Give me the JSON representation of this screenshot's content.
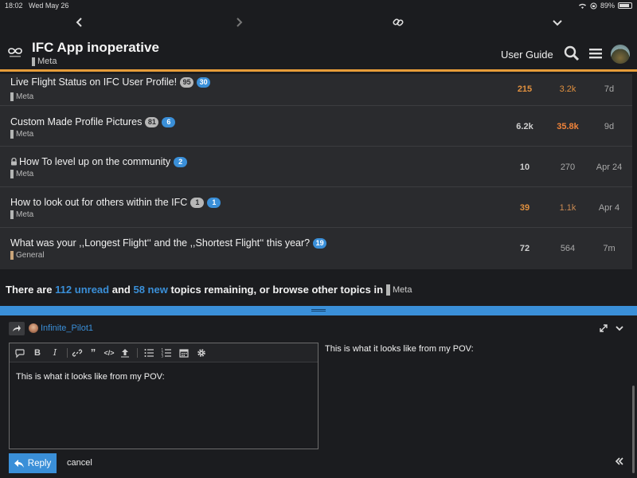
{
  "status": {
    "time": "18:02",
    "date": "Wed May 26",
    "battery": "89%",
    "battery_level": 0.89
  },
  "header": {
    "title": "IFC App inoperative",
    "category": "Meta",
    "category_color": "#b3b5b4",
    "user_guide": "User Guide"
  },
  "topics": [
    {
      "title": "Live Flight Status on IFC User Profile!",
      "badges": [
        "95",
        "30"
      ],
      "category": "Meta",
      "category_color": "#b3b5b4",
      "replies": "215",
      "views": "3.2k",
      "activity": "7d",
      "replies_color": "#e0903f",
      "views_color": "#e0903f",
      "locked": false
    },
    {
      "title": "Custom Made Profile Pictures",
      "badges": [
        "81",
        "6"
      ],
      "category": "Meta",
      "category_color": "#b3b5b4",
      "replies": "6.2k",
      "views": "35.8k",
      "activity": "9d",
      "replies_color": "#d0d0d0",
      "views_color": "#f0833a",
      "locked": false
    },
    {
      "title": "How To level up on the community",
      "badges": [
        "2"
      ],
      "category": "Meta",
      "category_color": "#b3b5b4",
      "replies": "10",
      "views": "270",
      "activity": "Apr 24",
      "replies_color": "#d0d0d0",
      "views_color": "#a9a9a9",
      "locked": true
    },
    {
      "title": "How to look out for others within the IFC",
      "badges": [
        "1",
        "1"
      ],
      "category": "Meta",
      "category_color": "#b3b5b4",
      "replies": "39",
      "views": "1.1k",
      "activity": "Apr 4",
      "replies_color": "#e0903f",
      "views_color": "#c98a52",
      "locked": false
    },
    {
      "title": "What was your ,,Longest Flight‘‘ and the ,,Shortest Flight‘‘ this year?",
      "badges": [
        "19"
      ],
      "category": "General",
      "category_color": "#c9a57a",
      "replies": "72",
      "views": "564",
      "activity": "7m",
      "replies_color": "#d0d0d0",
      "views_color": "#a9a9a9",
      "locked": false
    }
  ],
  "remaining": {
    "prefix": "There are",
    "unread": "112 unread",
    "and": "and",
    "new": "58 new",
    "suffix": "topics remaining, or browse other topics in",
    "category": "Meta"
  },
  "composer": {
    "reply_to_user": "Infinite_Pilot1",
    "editor_text": "This is what it looks like from my POV:",
    "preview_text": "This is what it looks like from my POV:",
    "reply_label": "Reply",
    "cancel_label": "cancel"
  },
  "colors": {
    "accent": "#3a8fd8",
    "header_border": "#e79d3a"
  }
}
